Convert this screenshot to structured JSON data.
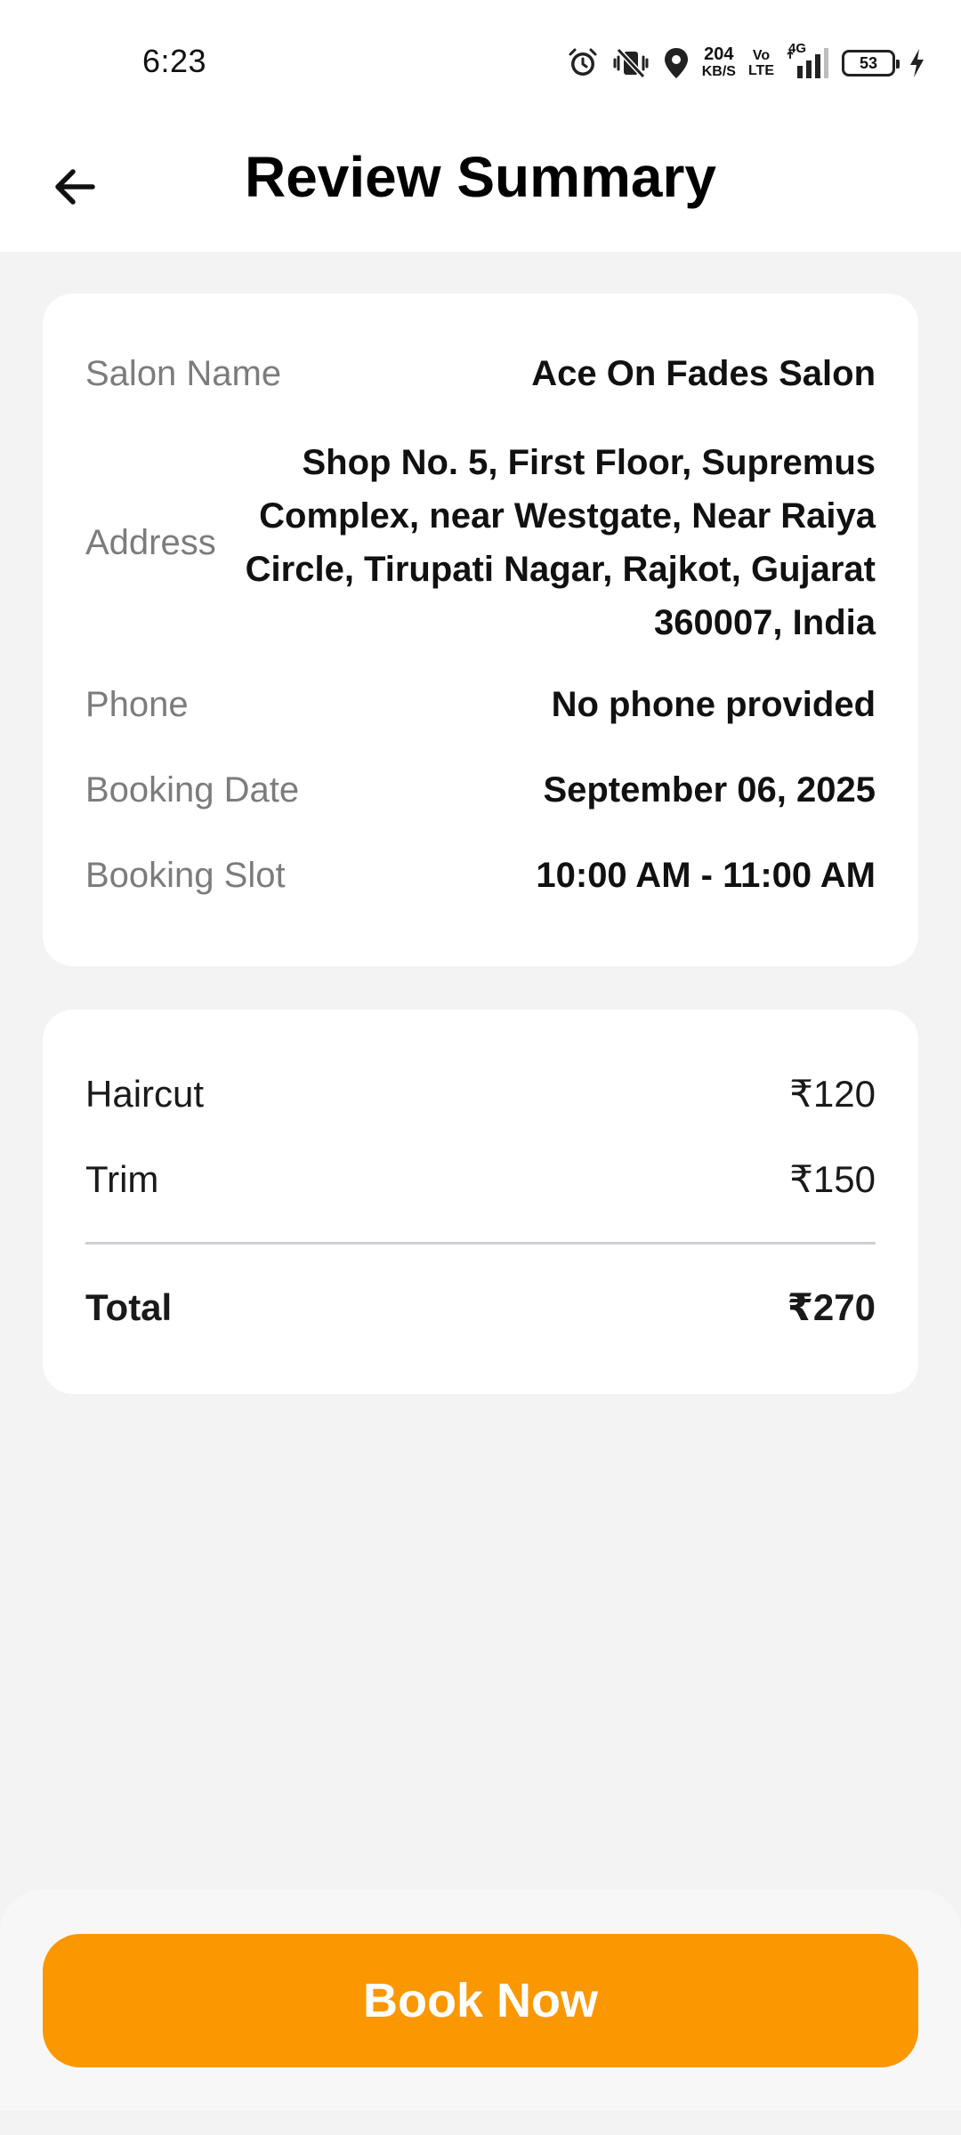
{
  "status_bar": {
    "time": "6:23",
    "network_speed_value": "204",
    "network_speed_unit": "KB/S",
    "volte_top": "Vo",
    "volte_bottom": "LTE",
    "network_type": "4G",
    "battery_level": "53",
    "icons": [
      "alarm-icon",
      "vibrate-off-icon",
      "location-icon",
      "signal-icon",
      "battery-icon",
      "charging-icon"
    ]
  },
  "header": {
    "title": "Review Summary",
    "back_icon": "arrow-left-icon"
  },
  "details": {
    "salon_name_label": "Salon Name",
    "salon_name_value": "Ace On Fades Salon",
    "address_label": "Address",
    "address_value": "Shop No. 5, First Floor, Supremus Complex, near Westgate, Near Raiya Circle, Tirupati Nagar, Rajkot, Gujarat 360007, India",
    "phone_label": "Phone",
    "phone_value": "No phone provided",
    "booking_date_label": "Booking Date",
    "booking_date_value": "September 06, 2025",
    "booking_slot_label": "Booking Slot",
    "booking_slot_value": "10:00 AM - 11:00 AM"
  },
  "pricing": {
    "items": [
      {
        "name": "Haircut",
        "price": "₹120"
      },
      {
        "name": "Trim",
        "price": "₹150"
      }
    ],
    "total_label": "Total",
    "total_value": "₹270"
  },
  "actions": {
    "book_now_label": "Book Now"
  },
  "colors": {
    "accent": "#fb9700",
    "background": "#f3f3f3",
    "card": "#ffffff",
    "label_gray": "#7c7c7c"
  }
}
